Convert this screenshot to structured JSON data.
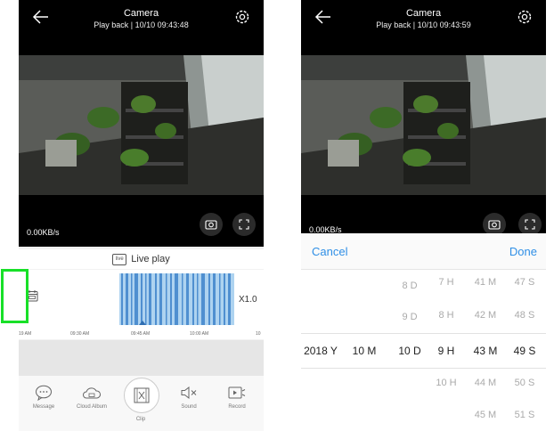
{
  "left": {
    "header": {
      "title": "Camera",
      "subtitle": "Play back | 10/10 09:43:48"
    },
    "speed": "0.00KB/s",
    "live_play": "Live play",
    "live_icon_text": "live",
    "playback_speed": "X1.0",
    "timeline_labels": [
      "19 AM",
      "09:30 AM",
      "09:45 AM",
      "10:00 AM",
      "10"
    ],
    "toolbar": [
      {
        "label": "Message",
        "icon": "message-icon"
      },
      {
        "label": "Cloud Album",
        "icon": "cloud-album-icon"
      },
      {
        "label": "Clip",
        "icon": "clip-icon"
      },
      {
        "label": "Sound",
        "icon": "sound-mute-icon"
      },
      {
        "label": "Record",
        "icon": "record-icon"
      }
    ]
  },
  "right": {
    "header": {
      "title": "Camera",
      "subtitle": "Play back | 10/10 09:43:59"
    },
    "speed_partial": "0.00KB/s",
    "picker": {
      "cancel": "Cancel",
      "done": "Done",
      "year": "2018 Y",
      "month": "10 M",
      "day": [
        "8 D",
        "9 D",
        "10 D"
      ],
      "hour": [
        "7 H",
        "8 H",
        "9 H",
        "10 H"
      ],
      "minute": [
        "41 M",
        "42 M",
        "43 M",
        "44 M",
        "45 M"
      ],
      "second": [
        "47 S",
        "48 S",
        "49 S",
        "50 S",
        "51 S"
      ]
    }
  },
  "colors": {
    "accent": "#2f8fe6",
    "highlight": "#18e028",
    "timeline": "#5b9fd8"
  }
}
